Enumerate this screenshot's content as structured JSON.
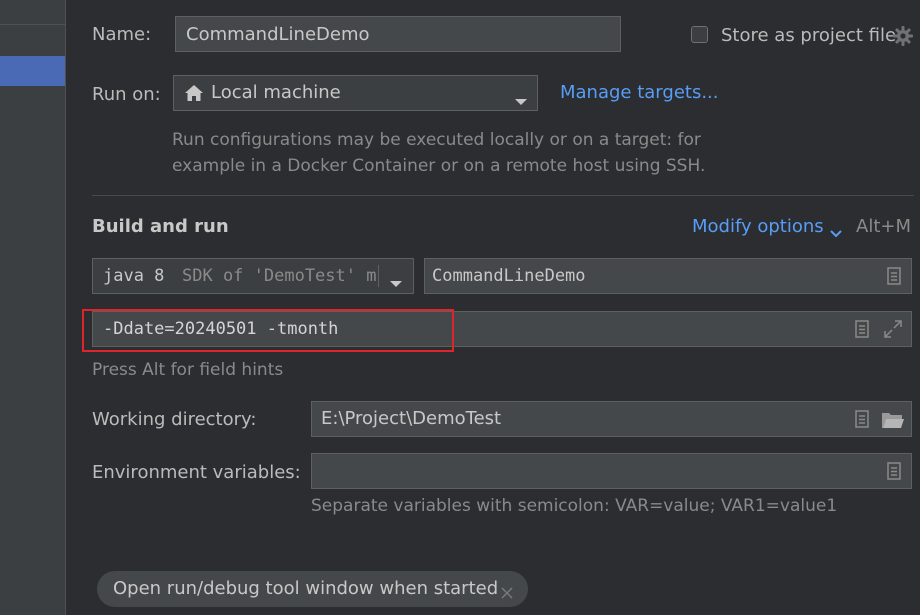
{
  "form": {
    "name_label": "Name:",
    "name_value": "CommandLineDemo",
    "store_label": "Store as project file",
    "run_on_label": "Run on:",
    "run_on_value": "Local machine",
    "manage_targets": "Manage targets...",
    "run_on_hint_line1": "Run configurations may be executed locally or on a target: for",
    "run_on_hint_line2": "example in a Docker Container or on a remote host using SSH."
  },
  "build": {
    "title": "Build and run",
    "modify_options": "Modify options",
    "modify_shortcut": "Alt+M",
    "sdk_version": "java 8",
    "sdk_desc": "SDK of 'DemoTest' m",
    "main_class": "CommandLineDemo",
    "program_args": "-Ddate=20240501 -tmonth",
    "field_hint": "Press Alt for field hints"
  },
  "workdir": {
    "label": "Working directory:",
    "value": "E:\\Project\\DemoTest"
  },
  "env": {
    "label": "Environment variables:",
    "value": "",
    "hint": "Separate variables with semicolon: VAR=value; VAR1=value1"
  },
  "tags": {
    "open_tool_window": "Open run/debug tool window when started"
  },
  "colors": {
    "accent_link": "#589df6",
    "highlight_border": "#e0242b",
    "selection": "#4a6ab6"
  }
}
